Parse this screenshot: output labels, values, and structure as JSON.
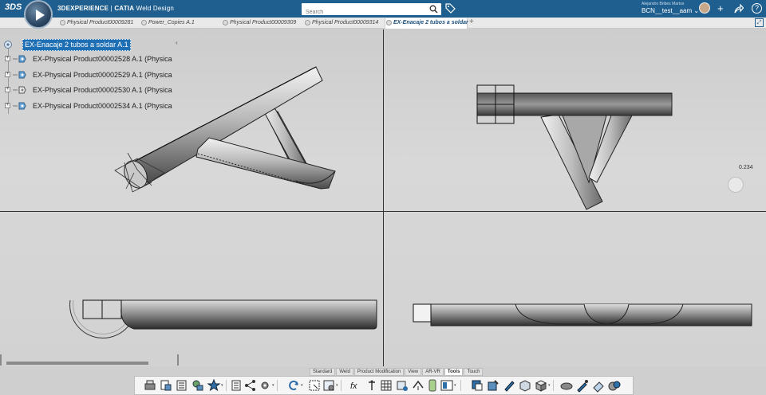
{
  "header": {
    "brand_prefix": "3DEXPERIENCE",
    "brand_app": "CATIA",
    "brand_module": "Weld Design",
    "search_placeholder": "Search",
    "user_fullname": "Alejandro Bribes Martos",
    "user_tenant": "BCN__test__aam"
  },
  "tabs": [
    {
      "label": "Physical Product00009281"
    },
    {
      "label": "Power_Copies A.1"
    },
    {
      "label": "Physical Product00009309"
    },
    {
      "label": "Physical Product00009314"
    },
    {
      "label": "EX-Enacaje 2 tubos a soldar"
    }
  ],
  "tree": {
    "root": "EX-Enacaje 2 tubos a soldar A.1",
    "children": [
      "EX-Physical Product00002528 A.1 (Physica",
      "EX-Physical Product00002529 A.1 (Physica",
      "EX-Physical Product00002530 A.1 (Physica",
      "EX-Physical Product00002534 A.1 (Physica"
    ]
  },
  "viewport": {
    "measurement": "0.234"
  },
  "app_tabs": [
    "Standard",
    "Weld",
    "Product Modification",
    "View",
    "AR-VR",
    "Tools",
    "Touch"
  ],
  "active_app_tab": "Tools",
  "toolbar_icons": [
    "3d-print-icon",
    "import-icon",
    "catalog-icon",
    "resources-icon",
    "favorites-icon",
    "list-icon",
    "tree-icon",
    "settings-icon",
    "refresh-icon",
    "table-icon",
    "formula-icon",
    "parameter-icon",
    "grid-icon",
    "measure-icon",
    "knowledge-icon",
    "battery-icon",
    "layout-icon",
    "relations-icon",
    "color-icon",
    "pen-icon",
    "apply-material-icon",
    "render-icon",
    "sphere-icon",
    "picker-icon",
    "eraser-icon",
    "cube-icon",
    "camera-icon"
  ],
  "colors": {
    "topbar": "#1f5f8f",
    "selection": "#1f6fb4",
    "viewport": "#cdcdcd"
  }
}
